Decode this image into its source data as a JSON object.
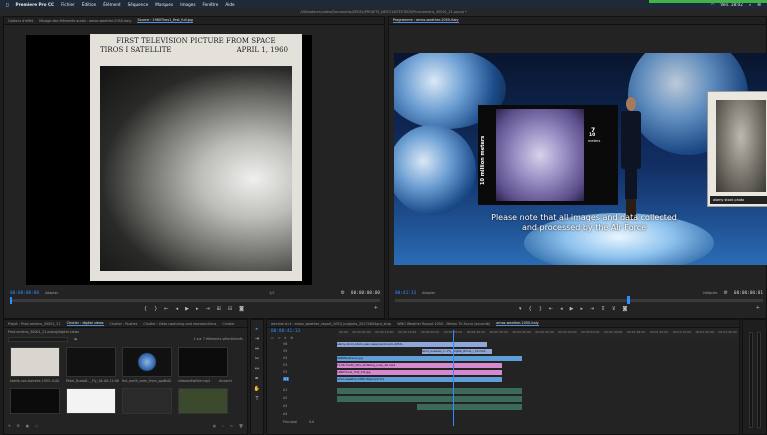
{
  "menubar": {
    "apple_glyph": "",
    "app_name": "Premiere Pro CC",
    "items": [
      "Fichier",
      "Édition",
      "Élément",
      "Séquence",
      "Marques",
      "Images",
      "Fenêtre",
      "Aide"
    ],
    "clock": "Ven. 18:02"
  },
  "window_title": "/Utilisateurs/video/Documents/ZEDSL/PROJETS_NEXT/16/TESTEDS/Prod-amiens_30001_21.prproj *",
  "source_panel": {
    "tabs": [
      "Options d'effet",
      "Mixage des éléments audio : amos-weather-2050-italy",
      "Source : 1960Tiros1_first_full.jpg"
    ],
    "timecode_left": "00:00:00:00",
    "zoom_label": "Adapter",
    "fraction": "1/2",
    "timecode_right": "00:00:00:00"
  },
  "source_image": {
    "line1": "FIRST TELEVISION PICTURE FROM SPACE",
    "line2_left": "TIROS I SATELLITE",
    "line2_right": "APRIL 1, 1960"
  },
  "program_panel": {
    "tab": "Programme : amos-weather-2050-italy",
    "timecode_left": "00:41:13",
    "zoom_label": "Adapter",
    "quality_label": "Intégrale",
    "timecode_right": "00:00:00:01",
    "inset_label_vertical": "10 million meters",
    "inset_label_right": "7",
    "inset_label_right2": "10",
    "inset_label_right3": "meters",
    "stock_label": "alamy stock photo",
    "subtitle_line1": "Please note that all images and data collected",
    "subtitle_line2": "and processed by the Air Force"
  },
  "project_panel": {
    "tabs": [
      "Projet : Prod-amiens_30001_21",
      "Chutier : digital views",
      "Chutier : Rushes",
      "Chutier : Data capturing and reproductions",
      "Chutier"
    ],
    "path": "Prod-amiens_30001_21.prproj/digital views",
    "count": "1 sur 7 éléments sélectionnés",
    "items": [
      {
        "name": "kaelle-von-balzeks-1955-...",
        "duration": "5:00"
      },
      {
        "name": "Peter_Busw6..._Fly_16...",
        "duration": "00:11:06"
      },
      {
        "name": "the_earth_seen_from_spac...",
        "duration": "5:00"
      },
      {
        "name": "videowillwhite.mp4",
        "duration": "Aneanti"
      },
      {
        "name": "",
        "duration": ""
      },
      {
        "name": "",
        "duration": ""
      },
      {
        "name": "",
        "duration": ""
      },
      {
        "name": "",
        "duration": ""
      }
    ]
  },
  "timeline_panel": {
    "tabs": [
      "amrsiar.rt.rt : amos_weather_report_2050_bulgaria_20170604gut_strip",
      "WNO Weather Report 2050 - Meteo TV Accra (accordé)",
      "amos-weather-2050-italy"
    ],
    "timecode": "00:00:41:13",
    "ruler_marks": [
      "00:00",
      "00:00:05:00",
      "00:00:10:00",
      "00:00:15:00",
      "00:00:20:00",
      "00:00:25:00",
      "00:00:30:00",
      "00:00:35:00",
      "00:00:40:00",
      "00:00:45:00",
      "00:00:50:00",
      "00:00:55:00",
      "00:01:00:00",
      "00:01:05:00",
      "00:01:10:00",
      "00:01:15:00",
      "00:01:20:00",
      "00:01:25:00"
    ],
    "tracks_video": [
      "V6",
      "V5",
      "V4",
      "V3",
      "V2",
      "V1"
    ],
    "tracks_audio": [
      "A1",
      "A2",
      "A3",
      "A4"
    ],
    "principal_label": "Principal",
    "principal_value": "0.0",
    "clips": [
      "alamy-stock-photo-jean-lapeyre-tornado-2050...",
      "Gerd_Ausweis_1...Fly_Digital_Rhine_i_10.mp4",
      "ARNWeather-0.jpg",
      "Tv.06: Earth_Ohio_Rotating_Loop_4K.mp4",
      "1960Tiros1_first_full.jpg",
      "amos-weather-2050-italy.mp4 [V]"
    ]
  }
}
